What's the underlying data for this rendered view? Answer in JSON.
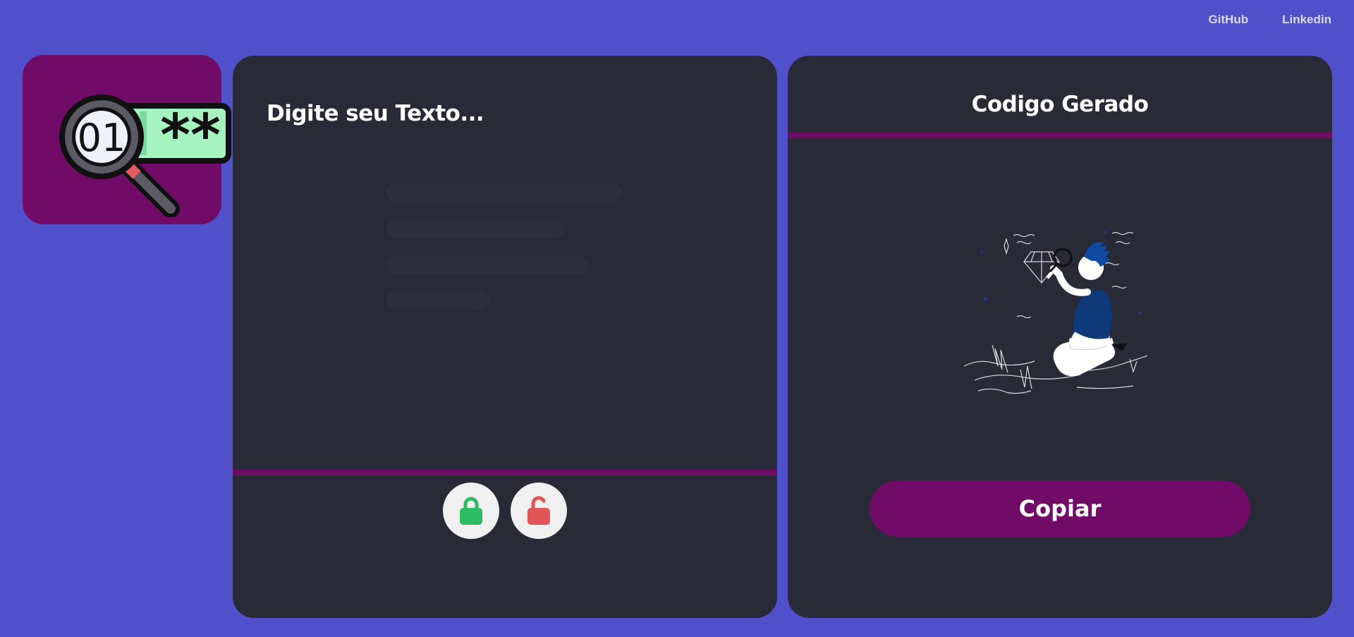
{
  "nav": {
    "github": "GitHub",
    "linkedin": "Linkedin"
  },
  "logo": {
    "digits": "01",
    "masked": "**"
  },
  "input_panel": {
    "title": "Digite seu Texto...",
    "text_value": "",
    "lock_icon": "lock-closed-icon",
    "unlock_icon": "lock-open-icon"
  },
  "output_panel": {
    "title": "Codigo Gerado",
    "illustration": "person-magnifying-diamond",
    "copy_label": "Copiar"
  },
  "colors": {
    "background": "#5050cb",
    "panel": "#292a37",
    "accent": "#700b68",
    "lock_green": "#2bbb62",
    "unlock_red": "#e05555"
  }
}
